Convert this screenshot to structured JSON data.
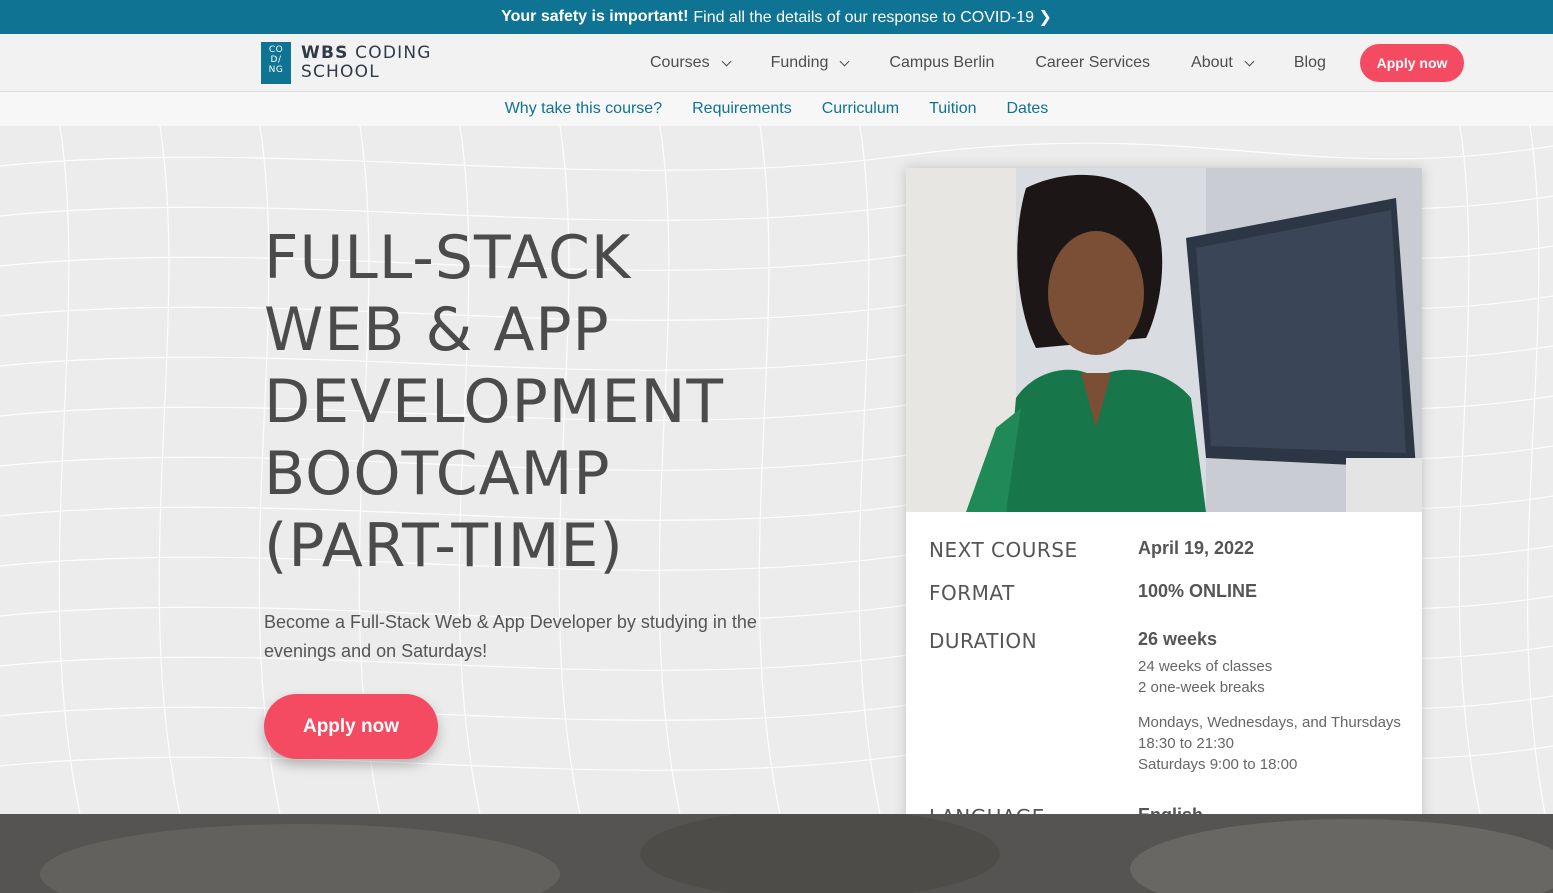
{
  "announcement": {
    "strong": "Your safety is important!",
    "text": "Find all the details of our response to COVID-19 ❯"
  },
  "logo": {
    "mark": [
      "CO",
      "D/",
      "NG"
    ],
    "line1_bold": "WBS",
    "line1_rest": " CODING",
    "line2": "SCHOOL"
  },
  "nav": {
    "items": [
      {
        "label": "Courses",
        "dropdown": true
      },
      {
        "label": "Funding",
        "dropdown": true
      },
      {
        "label": "Campus Berlin",
        "dropdown": false
      },
      {
        "label": "Career Services",
        "dropdown": false
      },
      {
        "label": "About",
        "dropdown": true
      },
      {
        "label": "Blog",
        "dropdown": false
      }
    ],
    "apply": "Apply now"
  },
  "subnav": {
    "items": [
      "Why take this course?",
      "Requirements",
      "Curriculum",
      "Tuition",
      "Dates"
    ]
  },
  "hero": {
    "title_lines": [
      "FULL-STACK",
      "WEB & APP",
      "DEVELOPMENT",
      "BOOTCAMP",
      "(PART-TIME)"
    ],
    "subtitle": "Become a Full-Stack Web & App Developer by studying in the evenings and on Saturdays!",
    "apply": "Apply now"
  },
  "card": {
    "next_course_label": "NEXT COURSE",
    "next_course_value": "April 19, 2022",
    "format_label": "FORMAT",
    "format_value": "100% ONLINE",
    "duration_label": "DURATION",
    "duration_value": "26 weeks",
    "duration_detail1": "24 weeks of classes",
    "duration_detail2": "2 one-week breaks",
    "schedule1": "Mondays, Wednesdays, and Thursdays",
    "schedule2": "18:30 to 21:30",
    "schedule3": "Saturdays 9:00 to 18:00",
    "language_label": "LANGUAGE",
    "language_value": "English"
  },
  "colors": {
    "brand_teal": "#0f7394",
    "accent_pink": "#f44b63",
    "text_gray": "#4b4b4b"
  }
}
